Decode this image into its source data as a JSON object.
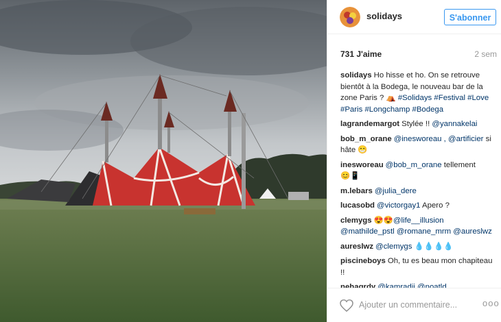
{
  "post": {
    "username": "solidays",
    "follow_label": "S'abonner",
    "likes": "731 J'aime",
    "time": "2 sem",
    "add_comment_placeholder": "Ajouter un commentaire...",
    "more_label": "ooo",
    "photo_alt": "Red and white circus tents under a cloudy sky on a grass field"
  },
  "comments": [
    {
      "author": "solidays",
      "text": "Ho hisse et ho. On se retrouve bientôt à la Bodega, le nouveau bar de la zone Paris ? ",
      "emoji": "⛺",
      "tags": "#Solidays #Festival #Love #Paris #Longchamp #Bodega"
    },
    {
      "author": "lagrandemargot",
      "text": "Stylée !! ",
      "tags": "@yannakelai"
    },
    {
      "author": "bob_m_orane",
      "text": "",
      "tags": "@inesworeau , @artificier",
      "text2": " si hâte ",
      "emoji": "😁"
    },
    {
      "author": "inesworeau",
      "text": "",
      "tags": "@bob_m_orane",
      "text2": " tellement ",
      "emoji": "😊📱"
    },
    {
      "author": "m.lebars",
      "text": "",
      "tags": "@julia_dere"
    },
    {
      "author": "lucasobd",
      "text": "",
      "tags": "@victorgay1",
      "text2": " Apero ?"
    },
    {
      "author": "clemygs",
      "text": "",
      "emoji": "😍😍 ",
      "tags": "@life__illusion @mathilde_pstl @romane_mrm @aureslwz"
    },
    {
      "author": "aureslwz",
      "text": "",
      "tags": "@clemygs",
      "text2": " ",
      "emoji": "💧💧💧💧"
    },
    {
      "author": "piscineboys",
      "text": "Oh, tu es beau mon chapiteau !!"
    },
    {
      "author": "nehagrdy",
      "text": "",
      "tags": "@kamradji @noatld"
    }
  ]
}
